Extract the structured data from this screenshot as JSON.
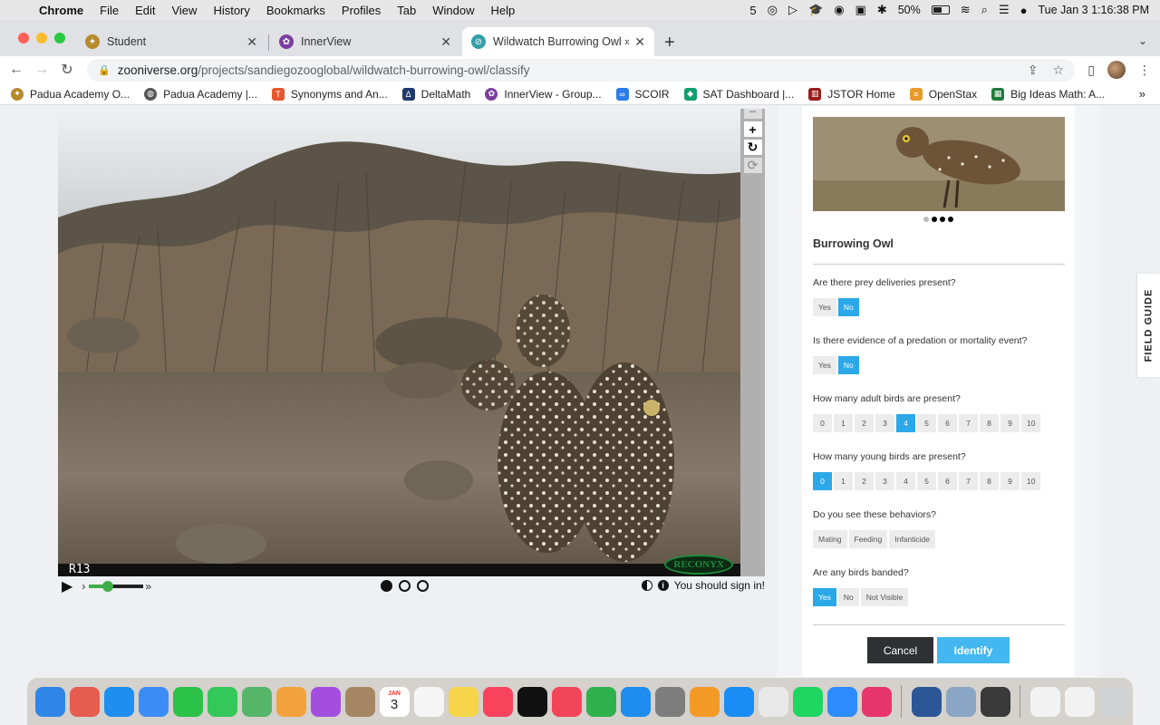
{
  "menubar": {
    "app": "Chrome",
    "items": [
      "File",
      "Edit",
      "View",
      "History",
      "Bookmarks",
      "Profiles",
      "Tab",
      "Window",
      "Help"
    ],
    "battery": "50%",
    "datetime": "Tue Jan 3  1:16:38 PM"
  },
  "tabs": [
    {
      "title": "Student",
      "active": false
    },
    {
      "title": "InnerView",
      "active": false
    },
    {
      "title": "Wildwatch Burrowing Owl » Cla",
      "active": true
    }
  ],
  "url": {
    "host": "zooniverse.org",
    "path": "/projects/sandiegozooglobal/wildwatch-burrowing-owl/classify"
  },
  "bookmarks": [
    {
      "label": "Padua Academy O...",
      "icon": "seal-icon",
      "color": "#b68b2c"
    },
    {
      "label": "Padua Academy |...",
      "icon": "globe-icon",
      "color": "#555555"
    },
    {
      "label": "Synonyms and An...",
      "icon": "thesaurus-icon",
      "color": "#e4572e"
    },
    {
      "label": "DeltaMath",
      "icon": "deltamath-icon",
      "color": "#1d3b6b"
    },
    {
      "label": "InnerView - Group...",
      "icon": "innerview-icon",
      "color": "#7b3fa0"
    },
    {
      "label": "SCOIR",
      "icon": "scoir-icon",
      "color": "#2b7de9"
    },
    {
      "label": "SAT Dashboard |...",
      "icon": "collegeboard-icon",
      "color": "#0e9f6e"
    },
    {
      "label": "JSTOR Home",
      "icon": "jstor-icon",
      "color": "#9b1c1c"
    },
    {
      "label": "OpenStax",
      "icon": "openstax-icon",
      "color": "#e89a2b"
    },
    {
      "label": "Big Ideas Math: A...",
      "icon": "bigideas-icon",
      "color": "#1f7a3a"
    }
  ],
  "subject": {
    "camera_label": "R13",
    "brand": "RECONYX",
    "sign_in_text": "You should sign in!",
    "playback_speed": 0.3,
    "frames": [
      true,
      false,
      false
    ]
  },
  "task": {
    "species": "Burrowing Owl",
    "questions": [
      {
        "q": "Are there prey deliveries present?",
        "answers": [
          "Yes",
          "No"
        ],
        "selected": [
          1
        ]
      },
      {
        "q": "Is there evidence of a predation or mortality event?",
        "answers": [
          "Yes",
          "No"
        ],
        "selected": [
          1
        ]
      },
      {
        "q": "How many adult birds are present?",
        "answers": [
          "0",
          "1",
          "2",
          "3",
          "4",
          "5",
          "6",
          "7",
          "8",
          "9",
          "10"
        ],
        "selected": [
          4
        ]
      },
      {
        "q": "How many young birds are present?",
        "answers": [
          "0",
          "1",
          "2",
          "3",
          "4",
          "5",
          "6",
          "7",
          "8",
          "9",
          "10"
        ],
        "selected": [
          0
        ]
      },
      {
        "q": "Do you see these behaviors?",
        "answers": [
          "Mating",
          "Feeding",
          "Infanticide"
        ],
        "selected": []
      },
      {
        "q": "Are any birds banded?",
        "answers": [
          "Yes",
          "No",
          "Not Visible"
        ],
        "selected": [
          0
        ]
      }
    ],
    "cancel_label": "Cancel",
    "identify_label": "Identify"
  },
  "field_guide_label": "FIELD GUIDE",
  "colors": {
    "accent": "#2aa8e8",
    "identify": "#43b7f0",
    "cancel": "#2f3033",
    "slider": "#3fae49"
  },
  "dock": {
    "calendar_month": "JAN",
    "calendar_day": "3",
    "apps": [
      {
        "name": "finder-icon",
        "color": "#2f86e6"
      },
      {
        "name": "launchpad-icon",
        "color": "#e65c4f"
      },
      {
        "name": "safari-icon",
        "color": "#1e8ef0"
      },
      {
        "name": "mail-icon",
        "color": "#3b8df5"
      },
      {
        "name": "facetime-icon",
        "color": "#2cc24a"
      },
      {
        "name": "messages-icon",
        "color": "#34c759"
      },
      {
        "name": "maps-icon",
        "color": "#55b66a"
      },
      {
        "name": "photos-icon",
        "color": "#f2a23c"
      },
      {
        "name": "podcasts-icon",
        "color": "#a44ee0"
      },
      {
        "name": "contacts-icon",
        "color": "#a58662"
      },
      {
        "name": "calendar-icon",
        "color": "#ffffff"
      },
      {
        "name": "reminders-icon",
        "color": "#f5f5f5"
      },
      {
        "name": "notes-icon",
        "color": "#f7d54a"
      },
      {
        "name": "music-icon",
        "color": "#f9435d"
      },
      {
        "name": "tv-icon",
        "color": "#111111"
      },
      {
        "name": "news-icon",
        "color": "#f3455a"
      },
      {
        "name": "numbers-icon",
        "color": "#2fb24c"
      },
      {
        "name": "keynote-icon",
        "color": "#1f8cf0"
      },
      {
        "name": "system-preferences-icon",
        "color": "#7d7d7d"
      },
      {
        "name": "pages-icon",
        "color": "#f39a26"
      },
      {
        "name": "app-store-icon",
        "color": "#1a8cf5"
      },
      {
        "name": "chrome-icon",
        "color": "#e8e8e8"
      },
      {
        "name": "spotify-icon",
        "color": "#1ed760"
      },
      {
        "name": "zoom-icon",
        "color": "#2d8cff"
      },
      {
        "name": "creative-cloud-icon",
        "color": "#e8356d"
      },
      {
        "name": "word-icon",
        "color": "#2b5797"
      },
      {
        "name": "preview-icon",
        "color": "#8ba6c4"
      },
      {
        "name": "quicktime-icon",
        "color": "#3a3a3a"
      },
      {
        "name": "document-icon",
        "color": "#f2f2f2"
      },
      {
        "name": "document-icon-2",
        "color": "#f2f2f2"
      },
      {
        "name": "trash-icon",
        "color": "#cfd3d6"
      }
    ]
  }
}
